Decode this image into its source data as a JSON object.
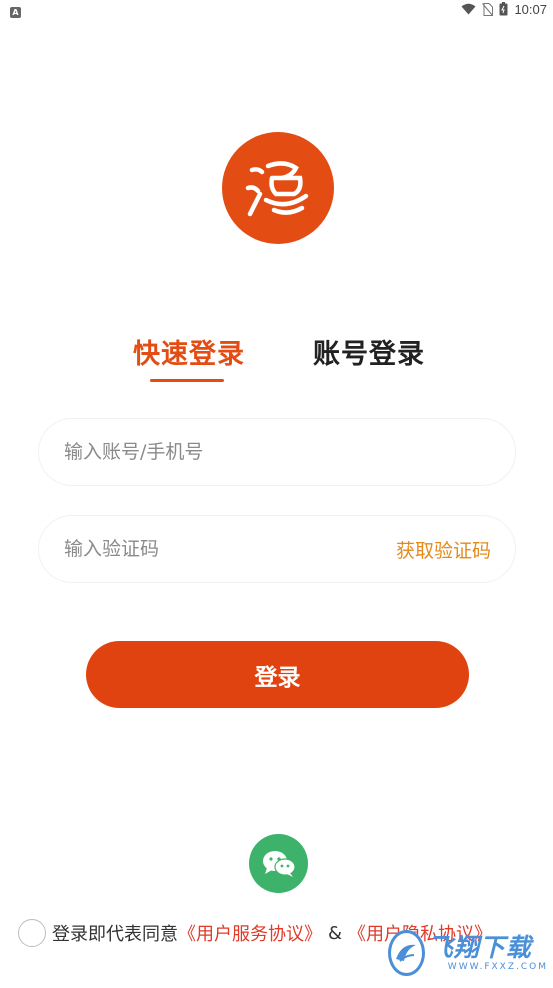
{
  "status_bar": {
    "left_badge": "A",
    "time": "10:07"
  },
  "logo": {
    "icon": "wine-bowl-logo-icon",
    "color": "#e34d14"
  },
  "tabs": [
    {
      "label": "快速登录",
      "active": true
    },
    {
      "label": "账号登录",
      "active": false
    }
  ],
  "form": {
    "account_placeholder": "输入账号/手机号",
    "account_value": "",
    "code_placeholder": "输入验证码",
    "code_value": "",
    "get_code_label": "获取验证码"
  },
  "login_button": {
    "label": "登录",
    "color": "#e0430f"
  },
  "social": {
    "wechat_icon": "wechat-icon",
    "color": "#3db26a"
  },
  "agreement": {
    "checked": false,
    "prefix": "登录即代表同意",
    "service_link": "《用户服务协议》",
    "amp": "&",
    "privacy_link": "《用户隐私协议》"
  },
  "watermark": {
    "main": "飞翔下载",
    "sub": "WWW.FXXZ.COM"
  }
}
